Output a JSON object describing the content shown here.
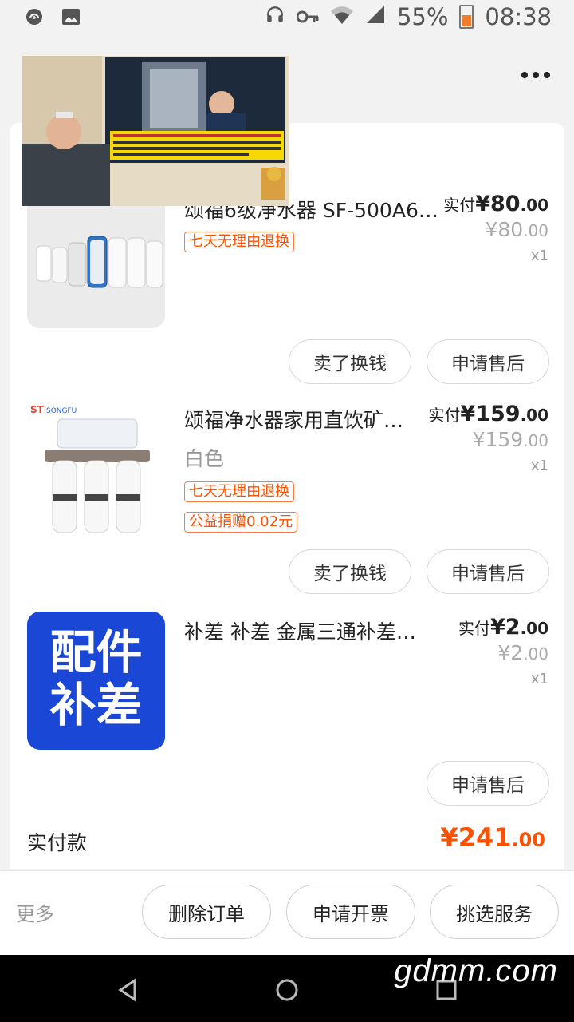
{
  "status_bar": {
    "battery": "55%",
    "time": "08:38"
  },
  "items": [
    {
      "title": "颂福6级净水器 SF-500A6…",
      "variant": "",
      "tags": [
        "七天无理由退换"
      ],
      "paid_label": "实付",
      "paid_int": "¥80",
      "paid_dec": ".00",
      "orig_int": "¥80",
      "orig_dec": ".00",
      "qty": "x1",
      "buttons": [
        "卖了换钱",
        "申请售后"
      ]
    },
    {
      "title": "颂福净水器家用直饮矿…",
      "variant": "白色",
      "tags": [
        "七天无理由退换",
        "公益捐赠0.02元"
      ],
      "paid_label": "实付",
      "paid_int": "¥159",
      "paid_dec": ".00",
      "orig_int": "¥159",
      "orig_dec": ".00",
      "qty": "x1",
      "buttons": [
        "卖了换钱",
        "申请售后"
      ]
    },
    {
      "title": "补差   补差   金属三通补差…",
      "thumb_text": [
        "配件",
        "补差"
      ],
      "paid_label": "实付",
      "paid_int": "¥2",
      "paid_dec": ".00",
      "orig_int": "¥2",
      "orig_dec": ".00",
      "qty": "x1",
      "buttons": [
        "申请售后"
      ]
    }
  ],
  "total": {
    "label": "实付款",
    "int": "¥241",
    "dec": ".00"
  },
  "action_bar": {
    "more": "更多",
    "delete": "删除订单",
    "invoice": "申请开票",
    "service": "挑选服务"
  },
  "watermark": "gdmm.com",
  "colors": {
    "accent": "#ff5000",
    "thumb_blue": "#1a47d6"
  }
}
